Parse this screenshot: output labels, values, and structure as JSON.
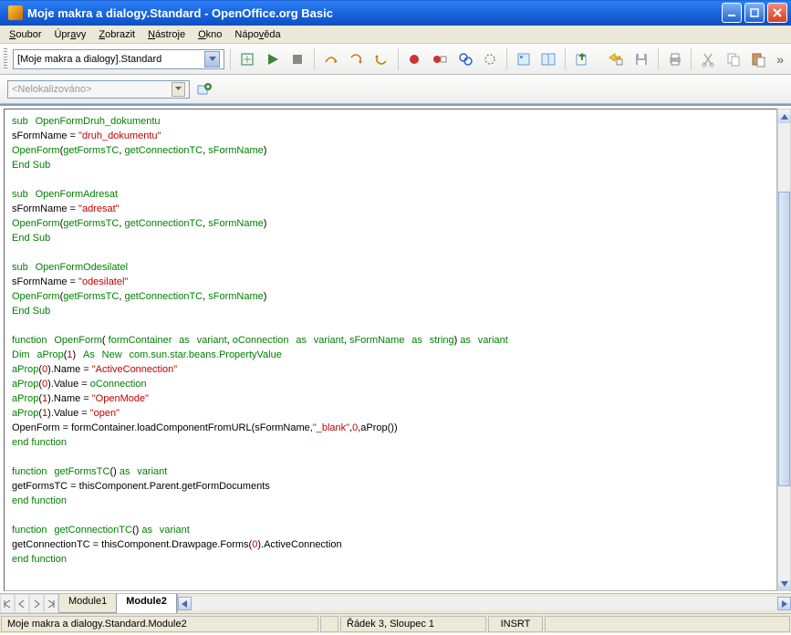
{
  "window": {
    "title": "Moje makra a dialogy.Standard - OpenOffice.org Basic"
  },
  "menu": {
    "soubor": "Soubor",
    "upravy": "Úpravy",
    "zobrazit": "Zobrazit",
    "nastroje": "Nástroje",
    "okno": "Okno",
    "napoveda": "Nápověda"
  },
  "toolbar": {
    "library_selected": "[Moje makra a dialogy].Standard",
    "combo2_placeholder": "<Nelokalizováno>"
  },
  "tabs": {
    "module1": "Module1",
    "module2": "Module2"
  },
  "status": {
    "path": "Moje makra a dialogy.Standard.Module2",
    "cursor": "Řádek 3, Sloupec 1",
    "mode": "INSRT"
  },
  "code": {
    "sub1_decl_sub": "sub",
    "sub1_decl_name": "OpenFormDruh_dokumentu",
    "sub1_l1a": "sFormName = ",
    "sub1_l1s": "\"druh_dokumentu\"",
    "call_open_a": "OpenForm",
    "call_open_b": "getFormsTC",
    "call_open_c": "getConnectionTC",
    "call_open_d": "sFormName",
    "endsub": "End Sub",
    "sub2_name": "OpenFormAdresat",
    "sub2_str": "\"adresat\"",
    "sub3_name": "OpenFormOdesilatel",
    "sub3_str": "\"odesilatel\"",
    "fn_kw": "function",
    "fn_name": "OpenForm",
    "fn_p1": "formContainer",
    "as": "as",
    "variant": "variant",
    "fn_p2": "oConnection",
    "fn_p3": "sFormName",
    "string": "string",
    "dim": "Dim",
    "aprop": "aProp",
    "As": "As",
    "New": "New",
    "comsun": "com.sun.star.beans.PropertyValue",
    "name_eq": ".Name = ",
    "val_eq": ".Value = ",
    "str_ac": "\"ActiveConnection\"",
    "str_om": "\"OpenMode\"",
    "str_open": "\"open\"",
    "oconn": "oConnection",
    "loadline_a": "OpenForm = formContainer.loadComponentFromURL(sFormName,",
    "loadline_s": "\"_blank\"",
    "loadline_b": ",",
    "loadline_c": ",aProp())",
    "endfn": "end function",
    "fn2_name": "getFormsTC",
    "fn2_body": "getFormsTC = thisComponent.Parent.getFormDocuments",
    "fn3_name": "getConnectionTC",
    "fn3_body_a": "getConnectionTC = thisComponent.Drawpage.Forms(",
    "fn3_body_b": ").ActiveConnection",
    "n0": "0",
    "n1": "1",
    "lp": "(",
    "rp": ")",
    "comma": ", "
  }
}
